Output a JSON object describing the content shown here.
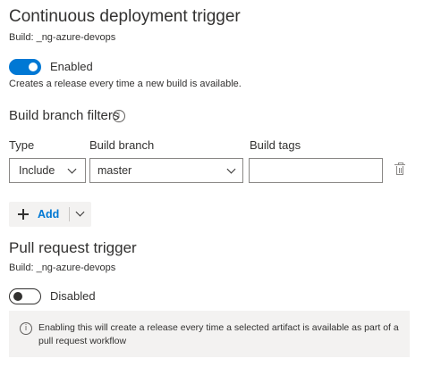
{
  "cd_trigger": {
    "title": "Continuous deployment trigger",
    "build": "Build: _ng-azure-devops",
    "toggle_state": "on",
    "toggle_label": "Enabled",
    "description": "Creates a release every time a new build is available."
  },
  "branch_filters": {
    "heading": "Build branch filters",
    "columns": {
      "type": "Type",
      "branch": "Build branch",
      "tags": "Build tags"
    },
    "row": {
      "type_value": "Include",
      "branch_value": "master",
      "tags_value": ""
    },
    "add_label": "Add"
  },
  "pr_trigger": {
    "title": "Pull request trigger",
    "build": "Build: _ng-azure-devops",
    "toggle_state": "off",
    "toggle_label": "Disabled",
    "info_message": "Enabling this will create a release every time a selected artifact is available as part of a pull request workflow"
  },
  "icons": {
    "info": "info-circle-icon",
    "delete": "trash-icon",
    "add": "plus-icon",
    "dropdown": "chevron-down-icon"
  },
  "colors": {
    "accent": "#0078d4",
    "infobar_bg": "#f3f2f1",
    "text": "#323130"
  }
}
